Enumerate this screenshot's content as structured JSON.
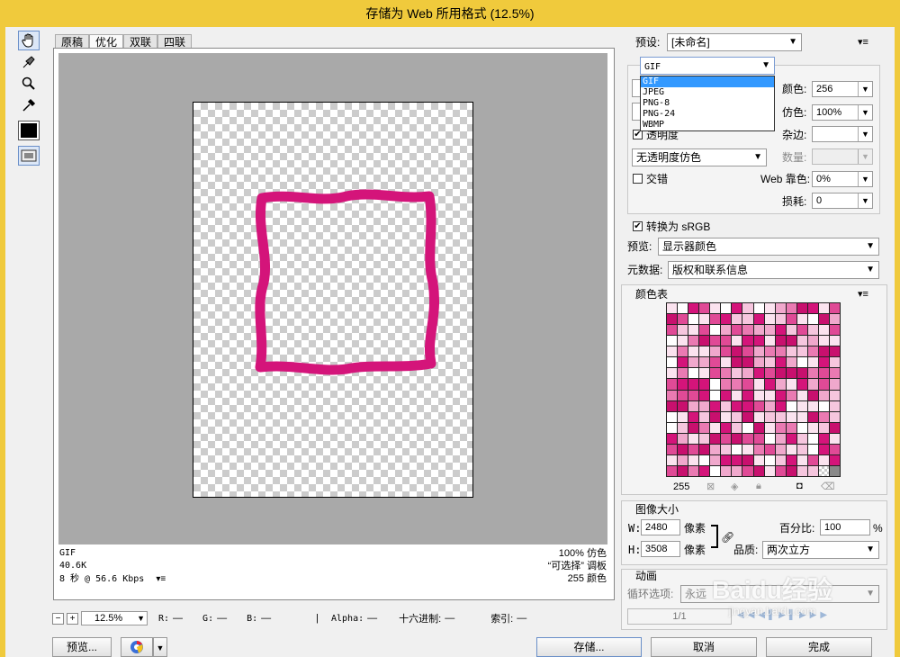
{
  "window": {
    "title": "存储为 Web 所用格式 (12.5%)"
  },
  "tabs": [
    {
      "label": "原稿"
    },
    {
      "label": "优化"
    },
    {
      "label": "双联"
    },
    {
      "label": "四联"
    }
  ],
  "info": {
    "format": "GIF",
    "size": "40.6K",
    "time": "8 秒 @ 56.6 Kbps",
    "dither": "100% 仿色",
    "palette": "“可选择” 调板",
    "colors": "255 颜色"
  },
  "statusbar": {
    "zoom": "12.5%",
    "r_label": "R:",
    "r_value": "—",
    "g_label": "G:",
    "g_value": "—",
    "b_label": "B:",
    "b_value": "—",
    "alpha_label": "Alpha:",
    "alpha_value": "—",
    "hex_label": "十六进制:",
    "hex_value": "—",
    "index_label": "索引:",
    "index_value": "—"
  },
  "preset": {
    "label": "预设:",
    "value": "[未命名]"
  },
  "format_select": {
    "value": "GIF",
    "options": [
      "GIF",
      "JPEG",
      "PNG-8",
      "PNG-24",
      "WBMP"
    ]
  },
  "settings": {
    "colors_label": "颜色:",
    "colors_value": "256",
    "dither_label": "仿色:",
    "dither_value": "100%",
    "matte_label": "杂边:",
    "matte_value": "",
    "transparency_label": "透明度",
    "transparency_checked": true,
    "trans_dither_value": "无透明度仿色",
    "amount_label": "数量:",
    "amount_value": "",
    "interlace_label": "交错",
    "interlace_checked": false,
    "websnap_label": "Web 靠色:",
    "websnap_value": "0%",
    "lossy_label": "损耗:",
    "lossy_value": "0"
  },
  "convert": {
    "label": "转换为 sRGB",
    "checked": true
  },
  "preview": {
    "label": "预览:",
    "value": "显示器颜色"
  },
  "metadata": {
    "label": "元数据:",
    "value": "版权和联系信息"
  },
  "color_table": {
    "title": "颜色表",
    "count": "255"
  },
  "image_size": {
    "title": "图像大小",
    "w_label": "W:",
    "w_value": "2480",
    "w_unit": "像素",
    "h_label": "H:",
    "h_value": "3508",
    "h_unit": "像素",
    "percent_label": "百分比:",
    "percent_value": "100",
    "percent_unit": "%",
    "quality_label": "品质:",
    "quality_value": "两次立方"
  },
  "animation": {
    "title": "动画",
    "loop_label": "循环选项:",
    "loop_value": "永远",
    "frame_counter": "1/1"
  },
  "buttons": {
    "preview": "预览...",
    "save": "存储...",
    "cancel": "取消",
    "done": "完成"
  },
  "watermark": {
    "text": "Baidu经验",
    "url": "jingyan.baidu.com"
  },
  "colors": {
    "title_bar": "#f0ca3c",
    "frame_stroke": "#d4147a",
    "selection": "#3399ff"
  }
}
